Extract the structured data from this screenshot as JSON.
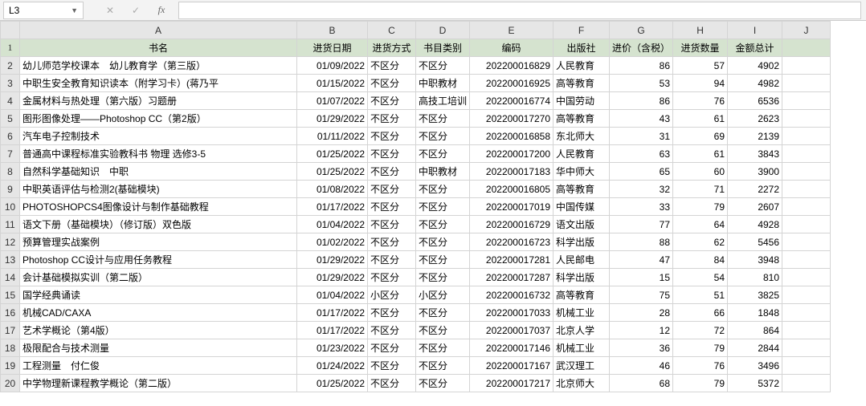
{
  "namebox": "L3",
  "fn_cancel": "✕",
  "fn_confirm": "✓",
  "fn_fx": "fx",
  "col_letters": [
    "A",
    "B",
    "C",
    "D",
    "E",
    "F",
    "G",
    "H",
    "I",
    "J"
  ],
  "headers": [
    "书名",
    "进货日期",
    "进货方式",
    "书目类别",
    "编码",
    "出版社",
    "进价（含税）",
    "进货数量",
    "金额总计",
    ""
  ],
  "rows": [
    [
      "幼儿师范学校课本　幼儿教育学（第三版）",
      "01/09/2022",
      "不区分",
      "不区分",
      "202200016829",
      "人民教育",
      "86",
      "57",
      "4902"
    ],
    [
      "中职生安全教育知识读本（附学习卡）(蒋乃平 ",
      "01/15/2022",
      "不区分",
      "中职教材",
      "202200016925",
      "高等教育",
      "53",
      "94",
      "4982"
    ],
    [
      "金属材料与热处理（第六版）习题册",
      "01/07/2022",
      "不区分",
      "高技工培训",
      "202200016774",
      "中国劳动",
      "86",
      "76",
      "6536"
    ],
    [
      "图形图像处理——Photoshop CC（第2版）",
      "01/29/2022",
      "不区分",
      "不区分",
      "202200017270",
      "高等教育",
      "43",
      "61",
      "2623"
    ],
    [
      "汽车电子控制技术",
      "01/11/2022",
      "不区分",
      "不区分",
      "202200016858",
      "东北师大",
      "31",
      "69",
      "2139"
    ],
    [
      "普通高中课程标准实验教科书 物理 选修3-5",
      "01/25/2022",
      "不区分",
      "不区分",
      "202200017200",
      "人民教育",
      "63",
      "61",
      "3843"
    ],
    [
      "自然科学基础知识　中职",
      "01/25/2022",
      "不区分",
      "中职教材",
      "202200017183",
      "华中师大",
      "65",
      "60",
      "3900"
    ],
    [
      "中职英语评估与检测2(基础模块)",
      "01/08/2022",
      "不区分",
      "不区分",
      "202200016805",
      "高等教育",
      "32",
      "71",
      "2272"
    ],
    [
      "PHOTOSHOPCS4图像设计与制作基础教程",
      "01/17/2022",
      "不区分",
      "不区分",
      "202200017019",
      "中国传媒",
      "33",
      "79",
      "2607"
    ],
    [
      "语文下册（基础模块）（修订版）双色版",
      "01/04/2022",
      "不区分",
      "不区分",
      "202200016729",
      "语文出版",
      "77",
      "64",
      "4928"
    ],
    [
      "预算管理实战案例",
      "01/02/2022",
      "不区分",
      "不区分",
      "202200016723",
      "科学出版",
      "88",
      "62",
      "5456"
    ],
    [
      "Photoshop CC设计与应用任务教程",
      "01/29/2022",
      "不区分",
      "不区分",
      "202200017281",
      "人民邮电",
      "47",
      "84",
      "3948"
    ],
    [
      "会计基础模拟实训（第二版）",
      "01/29/2022",
      "不区分",
      "不区分",
      "202200017287",
      "科学出版",
      "15",
      "54",
      "810"
    ],
    [
      "国学经典诵读",
      "01/04/2022",
      "小区分",
      "小区分",
      "202200016732",
      "高等教育",
      "75",
      "51",
      "3825"
    ],
    [
      "机械CAD/CAXA",
      "01/17/2022",
      "不区分",
      "不区分",
      "202200017033",
      "机械工业",
      "28",
      "66",
      "1848"
    ],
    [
      "艺术学概论（第4版）",
      "01/17/2022",
      "不区分",
      "不区分",
      "202200017037",
      "北京人学",
      "12",
      "72",
      "864"
    ],
    [
      "极限配合与技术测量",
      "01/23/2022",
      "不区分",
      "不区分",
      "202200017146",
      "机械工业",
      "36",
      "79",
      "2844"
    ],
    [
      "工程测量　付仁俊",
      "01/24/2022",
      "不区分",
      "不区分",
      "202200017167",
      "武汉理工",
      "46",
      "76",
      "3496"
    ],
    [
      "中学物理新课程教学概论（第二版）",
      "01/25/2022",
      "不区分",
      "不区分",
      "202200017217",
      "北京师大",
      "68",
      "79",
      "5372"
    ]
  ]
}
